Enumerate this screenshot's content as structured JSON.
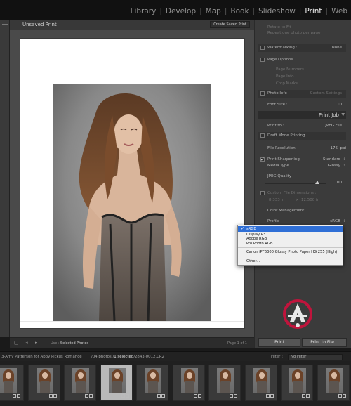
{
  "modules": [
    {
      "label": "Library",
      "active": false
    },
    {
      "label": "Develop",
      "active": false
    },
    {
      "label": "Map",
      "active": false
    },
    {
      "label": "Book",
      "active": false
    },
    {
      "label": "Slideshow",
      "active": false
    },
    {
      "label": "Print",
      "active": true
    },
    {
      "label": "Web",
      "active": false
    }
  ],
  "center": {
    "title": "Unsaved Print",
    "create_button": "Create Saved Print",
    "use_label": "Use :",
    "use_value": "Selected Photos",
    "page_of": "Page 1 of 1"
  },
  "right_panel": {
    "show_image_info": "Rotate to Fit",
    "repeat_one": "Repeat one photo per page",
    "watermarking": {
      "label": "Watermarking :",
      "value": "None"
    },
    "page_options": "Page Options",
    "page_numbers": "Page Numbers",
    "page_info": "Page Info",
    "crop_marks": "Crop Marks",
    "photo_info": {
      "label": "Photo Info :",
      "value": "Custom Settings"
    },
    "font_size": {
      "label": "Font Size :",
      "value": "10"
    },
    "print_job_title": "Print Job",
    "print_to": {
      "label": "Print to :",
      "value": "JPEG File"
    },
    "draft_mode": "Draft Mode Printing",
    "file_resolution": {
      "label": "File Resolution",
      "value": "176",
      "unit": "ppi"
    },
    "print_sharpening": {
      "label": "Print Sharpening",
      "value": "Standard"
    },
    "media_type": {
      "label": "Media Type",
      "value": "Glossy"
    },
    "jpeg_quality": {
      "label": "JPEG Quality",
      "value": "100",
      "fraction": 0.85
    },
    "custom_dimensions": "Custom File Dimensions :",
    "dim_w": "8.333 in",
    "dim_h": "12.500 in",
    "color_management": "Color Management",
    "profile": {
      "label": "Profile",
      "value": "sRGB"
    }
  },
  "profile_menu": {
    "items": [
      "sRGB",
      "Display P3",
      "Adobe RGB",
      "Pro Photo RGB"
    ],
    "printer_item": "Canon iPF6300 Glossy Photo Paper HG 255 (High)",
    "other": "Other..."
  },
  "buttons": {
    "print_label": "Print",
    "print_file_label": "Print to File..."
  },
  "filmstrip_bar": {
    "source": "3-Amy Patterson for Abby Pickus Romance",
    "count_pre": "/04 photos /",
    "count_sel": "1 selected",
    "file": "/2843-0012.CR2",
    "filter_label": "Filter :",
    "filter_value": "No Filter"
  },
  "colors": {
    "accent_blue": "#2f6fd6",
    "logo_red": "#c0143c",
    "active_module": "#ededed"
  },
  "filmstrip_selected_index": 3
}
